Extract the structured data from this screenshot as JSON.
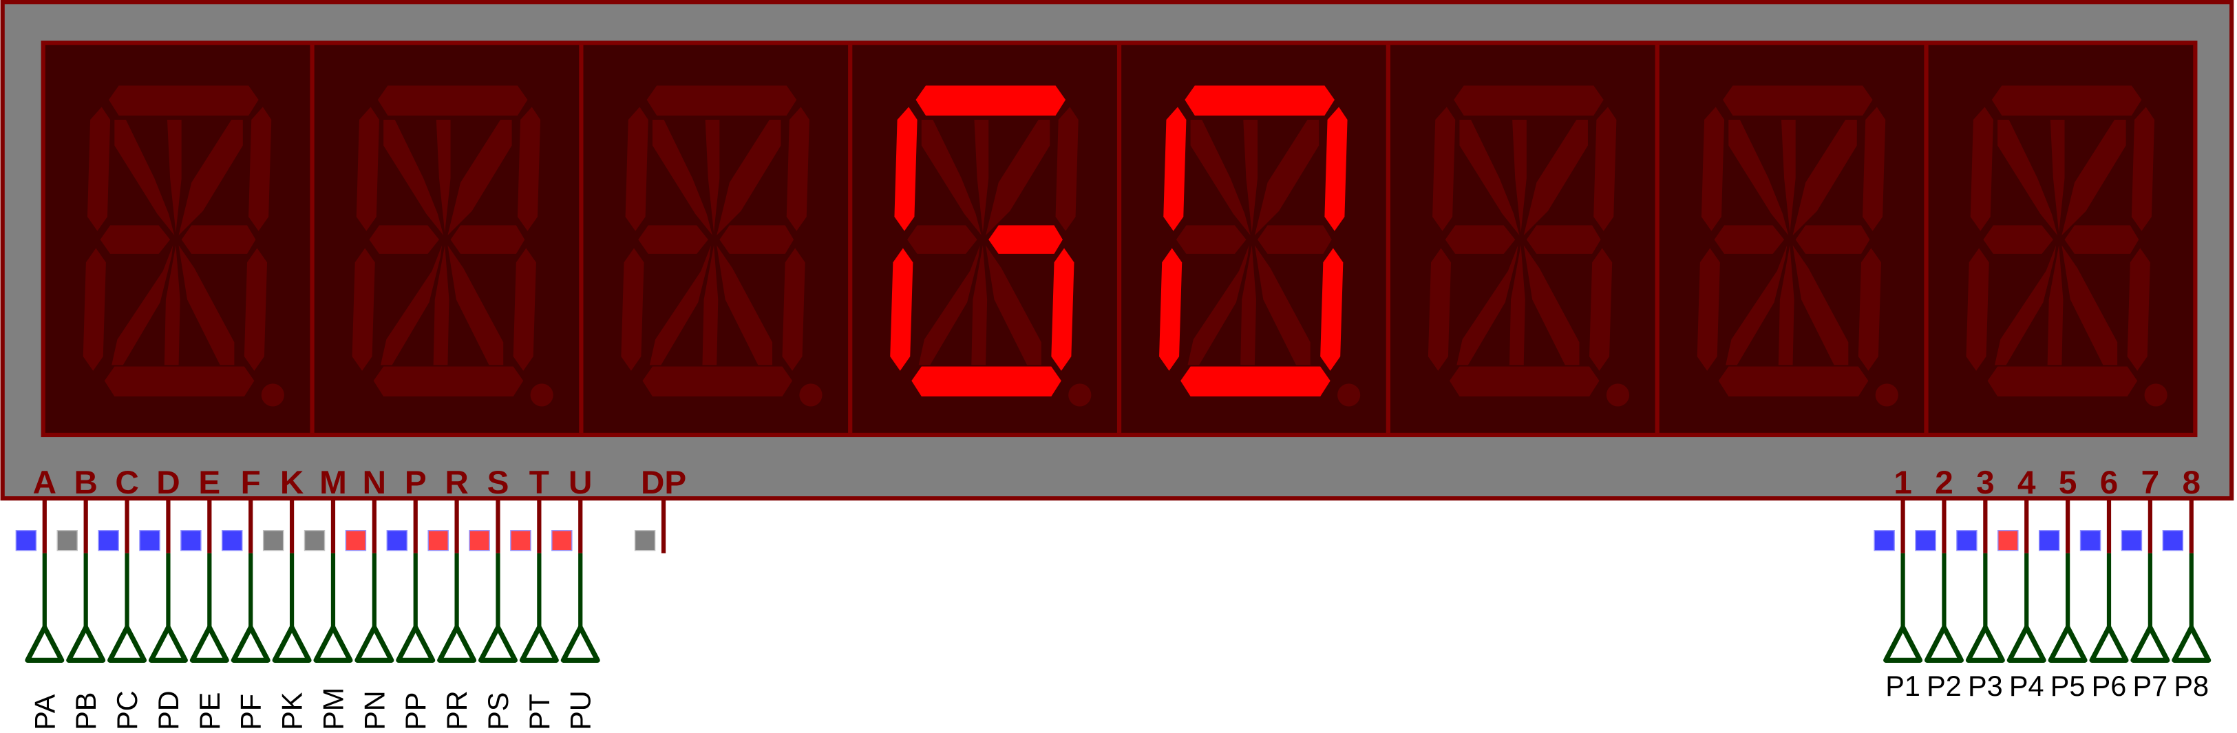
{
  "colors": {
    "body": "#808080",
    "border": "#800000",
    "display_bg": "#400000",
    "segment_off": "#5e0000",
    "segment_on": "#ff0000",
    "pin_upper": "#800000",
    "pin_lower": "#004000",
    "state_low": "#4040ff",
    "state_high": "#ff4040",
    "state_unknown": "#808080"
  },
  "display": {
    "shown_text": "GO",
    "digits": [
      {
        "lit": []
      },
      {
        "lit": []
      },
      {
        "lit": []
      },
      {
        "lit": [
          "A",
          "F",
          "E",
          "D",
          "C",
          "N"
        ]
      },
      {
        "lit": [
          "A",
          "B",
          "C",
          "D",
          "E",
          "F"
        ]
      },
      {
        "lit": []
      },
      {
        "lit": []
      },
      {
        "lit": []
      }
    ]
  },
  "segment_pins": [
    {
      "label": "A",
      "net": "PA",
      "state": "low"
    },
    {
      "label": "B",
      "net": "PB",
      "state": "unknown"
    },
    {
      "label": "C",
      "net": "PC",
      "state": "low"
    },
    {
      "label": "D",
      "net": "PD",
      "state": "low"
    },
    {
      "label": "E",
      "net": "PE",
      "state": "low"
    },
    {
      "label": "F",
      "net": "PF",
      "state": "low"
    },
    {
      "label": "K",
      "net": "PK",
      "state": "unknown"
    },
    {
      "label": "M",
      "net": "PM",
      "state": "unknown"
    },
    {
      "label": "N",
      "net": "PN",
      "state": "high"
    },
    {
      "label": "P",
      "net": "PP",
      "state": "low"
    },
    {
      "label": "R",
      "net": "PR",
      "state": "high"
    },
    {
      "label": "S",
      "net": "PS",
      "state": "high"
    },
    {
      "label": "T",
      "net": "PT",
      "state": "high"
    },
    {
      "label": "U",
      "net": "PU",
      "state": "high"
    }
  ],
  "dp_pin": {
    "label": "DP",
    "state": "unknown"
  },
  "digit_pins": [
    {
      "label": "1",
      "net": "P1",
      "state": "low"
    },
    {
      "label": "2",
      "net": "P2",
      "state": "low"
    },
    {
      "label": "3",
      "net": "P3",
      "state": "low"
    },
    {
      "label": "4",
      "net": "P4",
      "state": "high"
    },
    {
      "label": "5",
      "net": "P5",
      "state": "low"
    },
    {
      "label": "6",
      "net": "P6",
      "state": "low"
    },
    {
      "label": "7",
      "net": "P7",
      "state": "low"
    },
    {
      "label": "8",
      "net": "P8",
      "state": "low"
    }
  ]
}
